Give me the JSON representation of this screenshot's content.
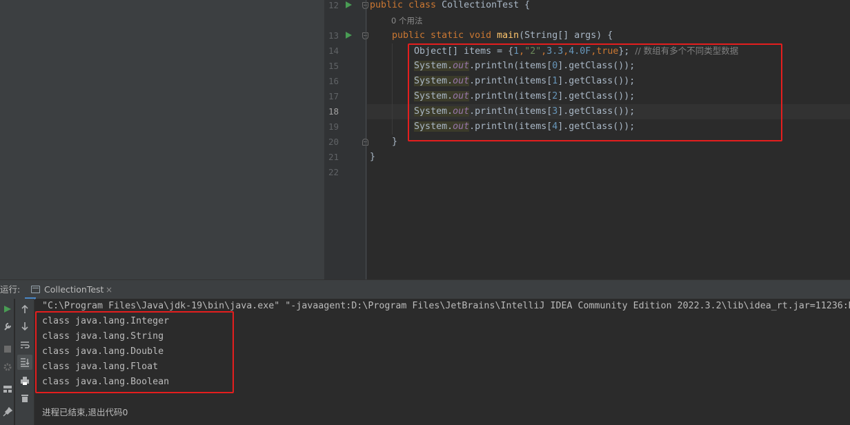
{
  "editor": {
    "lines": [
      {
        "number": "12",
        "run_icon": true,
        "fold": "open",
        "tokens": [
          {
            "t": "public class ",
            "c": "kw"
          },
          {
            "t": "CollectionTest",
            "c": ""
          },
          {
            "t": " {",
            "c": ""
          }
        ]
      },
      {
        "number": "",
        "hint": "0 个用法"
      },
      {
        "number": "13",
        "run_icon": true,
        "fold": "open",
        "tokens": [
          {
            "t": "    public static void ",
            "c": "kw"
          },
          {
            "t": "main",
            "c": "fn"
          },
          {
            "t": "(String[] args) {",
            "c": ""
          }
        ]
      },
      {
        "number": "14",
        "tokens": [
          {
            "t": "        ",
            "c": ""
          },
          {
            "t": "Object[] items = {",
            "c": ""
          },
          {
            "t": "1",
            "c": "num"
          },
          {
            "t": ",",
            "c": "kw"
          },
          {
            "t": "\"2\"",
            "c": "str"
          },
          {
            "t": ",",
            "c": "kw"
          },
          {
            "t": "3.3",
            "c": "num"
          },
          {
            "t": ",",
            "c": "kw"
          },
          {
            "t": "4.0F",
            "c": "num"
          },
          {
            "t": ",",
            "c": "kw"
          },
          {
            "t": "true",
            "c": "kw"
          },
          {
            "t": "}; ",
            "c": ""
          },
          {
            "t": "// 数组有多个不同类型数据",
            "c": "cmt"
          }
        ]
      },
      {
        "number": "15",
        "tokens": [
          {
            "t": "        ",
            "c": ""
          },
          {
            "t": "System.",
            "c": "sys"
          },
          {
            "t": "out",
            "c": "fld sys"
          },
          {
            "t": ".println(items[",
            "c": ""
          },
          {
            "t": "0",
            "c": "num"
          },
          {
            "t": "].getClass());",
            "c": ""
          }
        ]
      },
      {
        "number": "16",
        "tokens": [
          {
            "t": "        ",
            "c": ""
          },
          {
            "t": "System.",
            "c": "sys"
          },
          {
            "t": "out",
            "c": "fld sys"
          },
          {
            "t": ".println(items[",
            "c": ""
          },
          {
            "t": "1",
            "c": "num"
          },
          {
            "t": "].getClass());",
            "c": ""
          }
        ]
      },
      {
        "number": "17",
        "tokens": [
          {
            "t": "        ",
            "c": ""
          },
          {
            "t": "System.",
            "c": "sys"
          },
          {
            "t": "out",
            "c": "fld sys"
          },
          {
            "t": ".println(items[",
            "c": ""
          },
          {
            "t": "2",
            "c": "num"
          },
          {
            "t": "].getClass());",
            "c": ""
          }
        ]
      },
      {
        "number": "18",
        "current": true,
        "tokens": [
          {
            "t": "        ",
            "c": ""
          },
          {
            "t": "System.",
            "c": "sys"
          },
          {
            "t": "out",
            "c": "fld sys"
          },
          {
            "t": ".println(items[",
            "c": ""
          },
          {
            "t": "3",
            "c": "num"
          },
          {
            "t": "].getClass());",
            "c": ""
          }
        ]
      },
      {
        "number": "19",
        "tokens": [
          {
            "t": "        ",
            "c": ""
          },
          {
            "t": "System.",
            "c": "sys"
          },
          {
            "t": "out",
            "c": "fld sys"
          },
          {
            "t": ".println(items[",
            "c": ""
          },
          {
            "t": "4",
            "c": "num"
          },
          {
            "t": "].getClass());",
            "c": ""
          }
        ]
      },
      {
        "number": "20",
        "fold": "close",
        "tokens": [
          {
            "t": "    }",
            "c": ""
          }
        ]
      },
      {
        "number": "21",
        "tokens": [
          {
            "t": "}",
            "c": ""
          }
        ]
      },
      {
        "number": "22",
        "tokens": []
      }
    ]
  },
  "run_panel": {
    "label": "运行:",
    "tab_label": "CollectionTest",
    "tab_close": "×",
    "command_line": "\"C:\\Program Files\\Java\\jdk-19\\bin\\java.exe\" \"-javaagent:D:\\Program Files\\JetBrains\\IntelliJ IDEA Community Edition 2022.3.2\\lib\\idea_rt.jar=11236:D",
    "output": [
      "class java.lang.Integer",
      "class java.lang.String",
      "class java.lang.Double",
      "class java.lang.Float",
      "class java.lang.Boolean"
    ],
    "exit_message": "进程已结束,退出代码0"
  },
  "icons": {
    "run": "run-icon",
    "wrench": "wrench-icon",
    "stop": "stop-icon",
    "settings": "gear-icon",
    "layout": "layout-icon",
    "pin": "pin-icon",
    "up": "arrow-up-icon",
    "down": "arrow-down-icon",
    "wrap": "soft-wrap-icon",
    "scroll": "scroll-to-end-icon",
    "print": "print-icon",
    "trash": "trash-icon"
  },
  "colors": {
    "keyword": "#cc7832",
    "function": "#ffc66d",
    "number": "#6897bb",
    "string": "#6a8759",
    "annotation_box": "#e51e1e"
  }
}
